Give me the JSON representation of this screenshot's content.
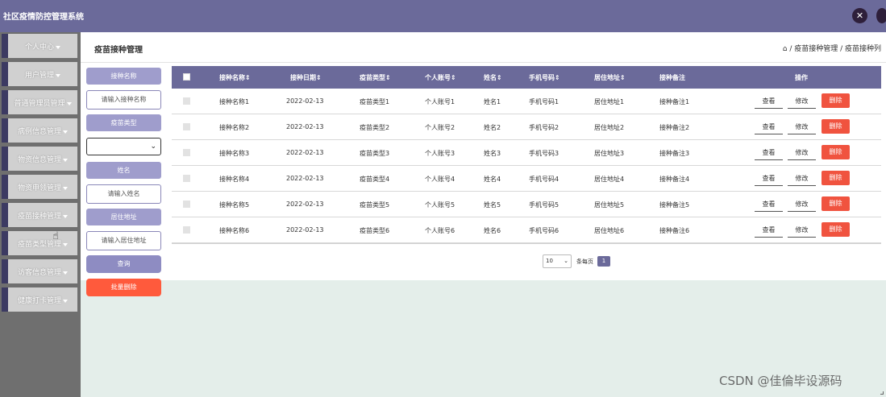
{
  "app": {
    "title": "社区疫情防控管理系统"
  },
  "header_icons": [
    "fullscreen-icon",
    "avatar-icon"
  ],
  "sidebar": {
    "items": [
      {
        "label": "个人中心",
        "active": false
      },
      {
        "label": "用户管理"
      },
      {
        "label": "普通管理员管理"
      },
      {
        "label": "病例信息管理"
      },
      {
        "label": "物资信息管理"
      },
      {
        "label": "物资申领管理"
      },
      {
        "label": "疫苗接种管理"
      },
      {
        "label": "疫苗类型管理"
      },
      {
        "label": "访客信息管理"
      },
      {
        "label": "健康打卡管理"
      }
    ]
  },
  "page": {
    "title": "疫苗接种管理",
    "breadcrumb": "⌂ / 疫苗接种管理 / 疫苗接种列"
  },
  "filters": {
    "name_label": "接种名称",
    "name_placeholder": "请输入接种名称",
    "type_label": "疫苗类型",
    "type_value": "",
    "person_label": "姓名",
    "person_placeholder": "请输入姓名",
    "address_label": "居住地址",
    "address_placeholder": "请输入居住地址",
    "query_button": "查询",
    "batch_delete_button": "批量删除"
  },
  "table": {
    "columns": [
      "接种名称",
      "接种日期",
      "疫苗类型",
      "个人账号",
      "姓名",
      "手机号码",
      "居住地址",
      "接种备注",
      "操作"
    ],
    "rows": [
      [
        "接种名称1",
        "2022-02-13",
        "疫苗类型1",
        "个人账号1",
        "姓名1",
        "手机号码1",
        "居住地址1",
        "接种备注1"
      ],
      [
        "接种名称2",
        "2022-02-13",
        "疫苗类型2",
        "个人账号2",
        "姓名2",
        "手机号码2",
        "居住地址2",
        "接种备注2"
      ],
      [
        "接种名称3",
        "2022-02-13",
        "疫苗类型3",
        "个人账号3",
        "姓名3",
        "手机号码3",
        "居住地址3",
        "接种备注3"
      ],
      [
        "接种名称4",
        "2022-02-13",
        "疫苗类型4",
        "个人账号4",
        "姓名4",
        "手机号码4",
        "居住地址4",
        "接种备注4"
      ],
      [
        "接种名称5",
        "2022-02-13",
        "疫苗类型5",
        "个人账号5",
        "姓名5",
        "手机号码5",
        "居住地址5",
        "接种备注5"
      ],
      [
        "接种名称6",
        "2022-02-13",
        "疫苗类型6",
        "个人账号6",
        "姓名6",
        "手机号码6",
        "居住地址6",
        "接种备注6"
      ]
    ],
    "actions": {
      "view": "查看",
      "edit": "修改",
      "delete": "删除"
    }
  },
  "pagination": {
    "page_size": "10",
    "per_page_label": "条每页",
    "current_page": "1"
  },
  "watermark": "CSDN @佳倫毕设源码",
  "colors": {
    "header": "#6b6a9a",
    "label": "#9f9dcc",
    "delete": "#f0533f",
    "batch_delete": "#ff5a3c",
    "sidebar": "#6f6f6f",
    "bottom": "#e4eeea"
  }
}
